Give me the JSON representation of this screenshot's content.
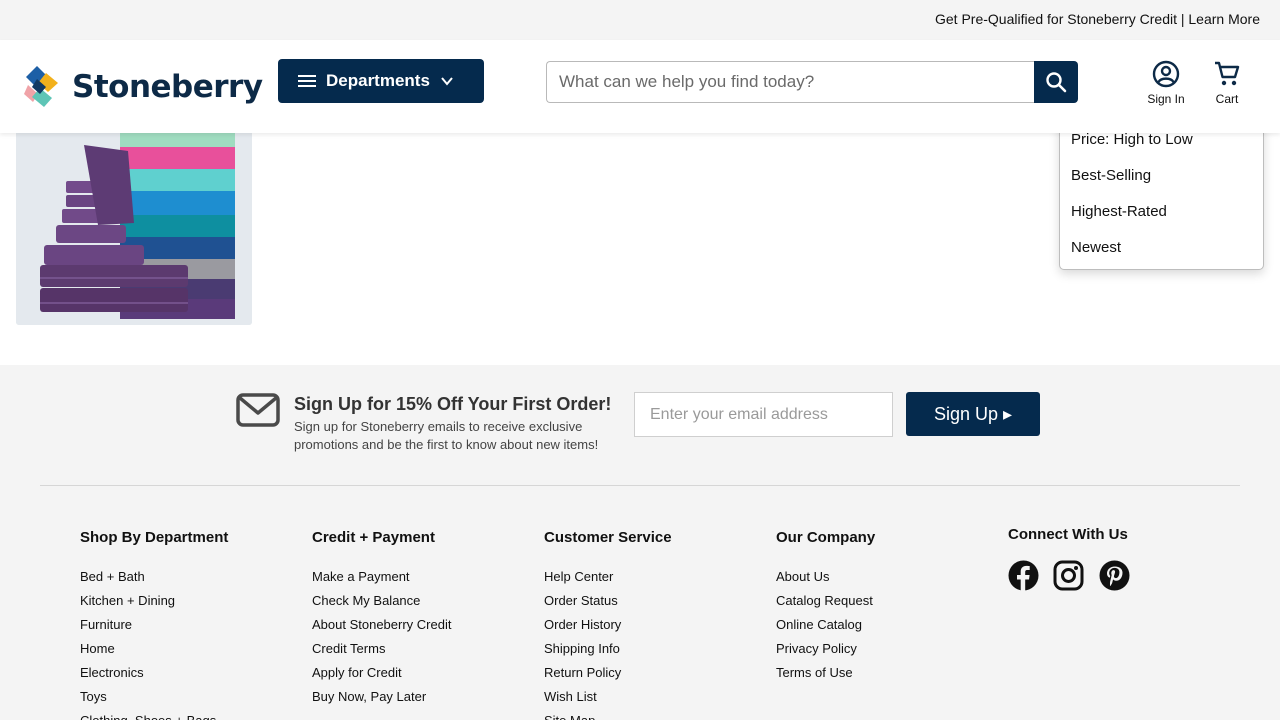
{
  "promo": {
    "text": "Get Pre-Qualified for Stoneberry Credit | Learn More"
  },
  "header": {
    "logo_text": "Stoneberry",
    "departments_label": "Departments",
    "search_placeholder": "What can we help you find today?",
    "sign_in_label": "Sign In",
    "cart_label": "Cart"
  },
  "sort_menu": {
    "options": [
      "Price: High to Low",
      "Best-Selling",
      "Highest-Rated",
      "Newest"
    ]
  },
  "newsletter": {
    "title": "Sign Up for 15% Off Your First Order!",
    "description": "Sign up for Stoneberry emails to receive exclusive promotions and be the first to know about new items!",
    "email_placeholder": "Enter your email address",
    "button_label": "Sign Up ▸"
  },
  "footer": {
    "columns": [
      {
        "title": "Shop By Department",
        "links": [
          "Bed + Bath",
          "Kitchen + Dining",
          "Furniture",
          "Home",
          "Electronics",
          "Toys",
          "Clothing, Shoes + Bags"
        ]
      },
      {
        "title": "Credit + Payment",
        "links": [
          "Make a Payment",
          "Check My Balance",
          "About Stoneberry Credit",
          "Credit Terms",
          "Apply for Credit",
          "Buy Now, Pay Later"
        ]
      },
      {
        "title": "Customer Service",
        "links": [
          "Help Center",
          "Order Status",
          "Order History",
          "Shipping Info",
          "Return Policy",
          "Wish List",
          "Site Map"
        ]
      },
      {
        "title": "Our Company",
        "links": [
          "About Us",
          "Catalog Request",
          "Online Catalog",
          "Privacy Policy",
          "Terms of Use"
        ]
      }
    ],
    "social_title": "Connect With Us",
    "social_icons": [
      "facebook-icon",
      "instagram-icon",
      "pinterest-icon"
    ]
  },
  "colors": {
    "brand_navy": "#052a4d",
    "footer_bg": "#f4f4f4",
    "promo_bg": "#f4f4f4"
  }
}
